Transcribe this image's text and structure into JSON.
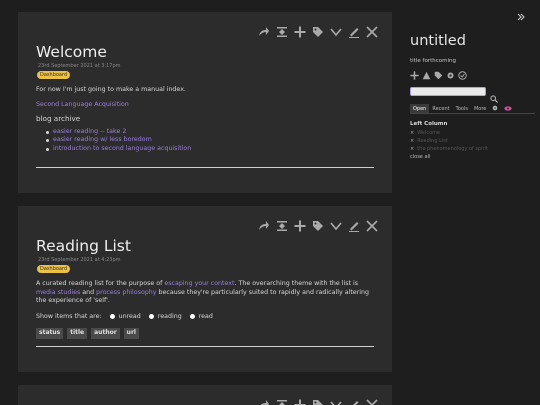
{
  "story": {
    "tiddlers": [
      {
        "title": "Welcome",
        "subtitle": "23rd September 2021 at 3:17pm",
        "tag": "Dashboard",
        "intro": "For now I'm just going to make a manual index.",
        "link1": "Second Language Acquisition",
        "archive_heading": "blog archive",
        "archive": [
          "easier reading -- take 2",
          "easier reading w/ less boredom",
          "introduction to second language acquisition"
        ]
      },
      {
        "title": "Reading List",
        "subtitle": "23rd September 2021 at 4:23pm",
        "tag": "Dashboard",
        "p1_a": "A curated reading list for the purpose of ",
        "p1_link1": "escaping your context",
        "p1_b": ". The overarching theme with the list is ",
        "p1_link2": "media studies",
        "p1_c": " and ",
        "p1_link3": "process philosophy",
        "p1_d": " because they're particularly suited to rapidly and radically altering the experience of 'self'.",
        "filter_label": "Show items that are:",
        "filters": [
          "unread",
          "reading",
          "read"
        ],
        "columns": [
          "status",
          "title",
          "author",
          "url"
        ]
      }
    ]
  },
  "sidebar": {
    "site_title": "untitled",
    "site_subtitle": "title forthcoming",
    "tabs": [
      "Open",
      "Recent",
      "Tools",
      "More"
    ],
    "column_heading": "Left Column",
    "open_items": [
      "Welcome",
      "Reading List",
      "the phenomenology of spirit"
    ],
    "close_all": "close all"
  },
  "colors": {
    "accent_link": "#9b7ee0",
    "tag": "#ecc145",
    "search_focus": "#b39cf0"
  }
}
